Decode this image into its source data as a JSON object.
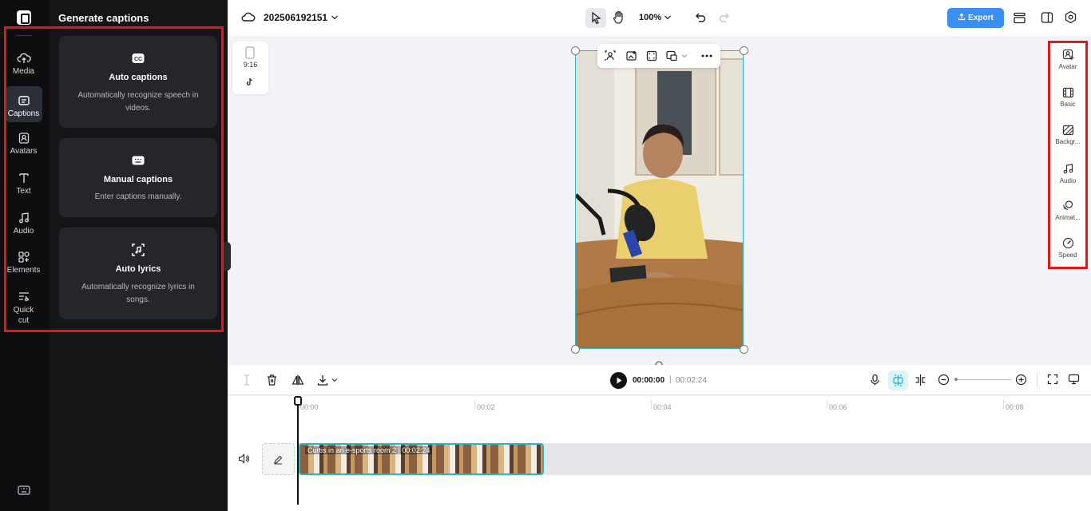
{
  "rail": {
    "items": [
      {
        "label": "Media",
        "icon": "cloud-upload-icon"
      },
      {
        "label": "Captions",
        "icon": "captions-icon"
      },
      {
        "label": "Avatars",
        "icon": "avatar-icon"
      },
      {
        "label": "Text",
        "icon": "text-icon"
      },
      {
        "label": "Audio",
        "icon": "music-note-icon"
      },
      {
        "label": "Elements",
        "icon": "elements-icon"
      },
      {
        "label": "Quick cut",
        "icon": "quick-cut-icon"
      }
    ],
    "active": "Captions"
  },
  "panel": {
    "title": "Generate captions",
    "cards": [
      {
        "title": "Auto captions",
        "desc": "Automatically recognize speech in videos.",
        "icon": "cc-icon"
      },
      {
        "title": "Manual captions",
        "desc": "Enter captions manually.",
        "icon": "keyboard-icon"
      },
      {
        "title": "Auto lyrics",
        "desc": "Automatically recognize lyrics in songs.",
        "icon": "lyrics-icon"
      }
    ]
  },
  "topbar": {
    "project_name": "202506192151",
    "zoom": "100%",
    "export_label": "Export"
  },
  "canvas": {
    "ratio": "9:16"
  },
  "right_panel": {
    "items": [
      {
        "label": "Avatar",
        "icon": "avatar-icon"
      },
      {
        "label": "Basic",
        "icon": "film-icon"
      },
      {
        "label": "Backgr...",
        "icon": "background-icon"
      },
      {
        "label": "Audio",
        "icon": "music-note-icon"
      },
      {
        "label": "Animat...",
        "icon": "animation-icon"
      },
      {
        "label": "Speed",
        "icon": "speed-icon"
      }
    ]
  },
  "timeline": {
    "current_time": "00:00:00",
    "separator": "|",
    "total_time": "00:02:24",
    "ticks": [
      "00:00",
      "00:02",
      "00:04",
      "00:06",
      "00:08"
    ],
    "clip_label": "Curtis in an e-sports room 2 | 00:02:24"
  },
  "colors": {
    "accent": "#3b8ff0",
    "selection": "#2cb5c8",
    "highlight_box": "#e01818"
  }
}
